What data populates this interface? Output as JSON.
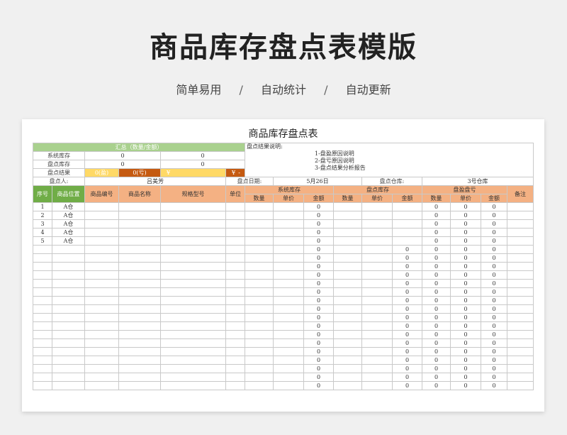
{
  "page": {
    "title": "商品库存盘点表模版",
    "features": [
      "简单易用",
      "自动统计",
      "自动更新"
    ],
    "separator": "/"
  },
  "sheet": {
    "title": "商品库存盘点表",
    "summary": {
      "header": "汇总（数量/金额）",
      "rows": [
        {
          "label": "系统库存",
          "qty": "0",
          "amount": "0"
        },
        {
          "label": "盘点库存",
          "qty": "0",
          "amount": "0"
        }
      ],
      "result": {
        "label": "盘点结果",
        "gain": "0(盈)",
        "loss": "0(亏)",
        "gain_amount": "¥",
        "loss_amount": "¥",
        "loss_dash": "-"
      }
    },
    "notes": {
      "title": "盘点结果说明:",
      "items": [
        "1-盘盈原因说明",
        "2-盘亏原因说明",
        "3-盘点结果分析报告"
      ]
    },
    "meta": {
      "counter_label": "盘点人:",
      "counter": "吕美芳",
      "date_label": "盘点日期:",
      "date": "5月26日",
      "warehouse_label": "盘点仓库:",
      "warehouse": "3号仓库"
    },
    "headers": {
      "seq": "序号",
      "location": "商品位置",
      "code": "商品编号",
      "name": "商品名称",
      "spec": "规格型号",
      "unit": "单位",
      "system_stock": "系统库存",
      "counted_stock": "盘点库存",
      "diff": "盘盈盘亏",
      "remark": "备注",
      "qty": "数量",
      "price": "单价",
      "amount": "金额"
    },
    "rows": [
      {
        "seq": "1",
        "loc": "A仓",
        "sys": "0",
        "cnt": "",
        "q": "0",
        "p": "0",
        "a": "0"
      },
      {
        "seq": "2",
        "loc": "A仓",
        "sys": "0",
        "cnt": "",
        "q": "0",
        "p": "0",
        "a": "0"
      },
      {
        "seq": "3",
        "loc": "A仓",
        "sys": "0",
        "cnt": "",
        "q": "0",
        "p": "0",
        "a": "0"
      },
      {
        "seq": "4",
        "loc": "A仓",
        "sys": "0",
        "cnt": "",
        "q": "0",
        "p": "0",
        "a": "0"
      },
      {
        "seq": "5",
        "loc": "A仓",
        "sys": "0",
        "cnt": "",
        "q": "0",
        "p": "0",
        "a": "0"
      },
      {
        "seq": "",
        "loc": "",
        "sys": "0",
        "cnt": "0",
        "q": "0",
        "p": "0",
        "a": "0"
      },
      {
        "seq": "",
        "loc": "",
        "sys": "0",
        "cnt": "0",
        "q": "0",
        "p": "0",
        "a": "0"
      },
      {
        "seq": "",
        "loc": "",
        "sys": "0",
        "cnt": "0",
        "q": "0",
        "p": "0",
        "a": "0"
      },
      {
        "seq": "",
        "loc": "",
        "sys": "0",
        "cnt": "0",
        "q": "0",
        "p": "0",
        "a": "0"
      },
      {
        "seq": "",
        "loc": "",
        "sys": "0",
        "cnt": "0",
        "q": "0",
        "p": "0",
        "a": "0"
      },
      {
        "seq": "",
        "loc": "",
        "sys": "0",
        "cnt": "0",
        "q": "0",
        "p": "0",
        "a": "0"
      },
      {
        "seq": "",
        "loc": "",
        "sys": "0",
        "cnt": "0",
        "q": "0",
        "p": "0",
        "a": "0"
      },
      {
        "seq": "",
        "loc": "",
        "sys": "0",
        "cnt": "0",
        "q": "0",
        "p": "0",
        "a": "0"
      },
      {
        "seq": "",
        "loc": "",
        "sys": "0",
        "cnt": "0",
        "q": "0",
        "p": "0",
        "a": "0"
      },
      {
        "seq": "",
        "loc": "",
        "sys": "0",
        "cnt": "0",
        "q": "0",
        "p": "0",
        "a": "0"
      },
      {
        "seq": "",
        "loc": "",
        "sys": "0",
        "cnt": "0",
        "q": "0",
        "p": "0",
        "a": "0"
      },
      {
        "seq": "",
        "loc": "",
        "sys": "0",
        "cnt": "0",
        "q": "0",
        "p": "0",
        "a": "0"
      },
      {
        "seq": "",
        "loc": "",
        "sys": "0",
        "cnt": "0",
        "q": "0",
        "p": "0",
        "a": "0"
      },
      {
        "seq": "",
        "loc": "",
        "sys": "0",
        "cnt": "0",
        "q": "0",
        "p": "0",
        "a": "0"
      },
      {
        "seq": "",
        "loc": "",
        "sys": "0",
        "cnt": "0",
        "q": "0",
        "p": "0",
        "a": "0"
      },
      {
        "seq": "",
        "loc": "",
        "sys": "0",
        "cnt": "0",
        "q": "0",
        "p": "0",
        "a": "0"
      },
      {
        "seq": "",
        "loc": "",
        "sys": "0",
        "cnt": "0",
        "q": "0",
        "p": "0",
        "a": "0"
      }
    ]
  },
  "colors": {
    "summary_green": "#a9d18e",
    "header_green": "#70ad47",
    "header_peach": "#f4b183",
    "result_yellow": "#ffd966",
    "result_orange": "#c55a11"
  }
}
